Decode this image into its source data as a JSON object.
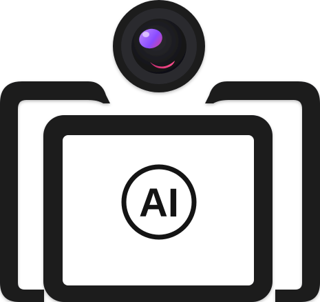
{
  "logo": {
    "badge_text": "AI",
    "icon_name": "ai-camera-monitor-icon",
    "colors": {
      "frame": "#1a1a1c",
      "background": "#ffffff",
      "lens_outer": "#222226",
      "lens_inner": "#141416",
      "lens_highlight_purple": "#9b5cff",
      "lens_highlight_pink": "#e0407a"
    }
  }
}
